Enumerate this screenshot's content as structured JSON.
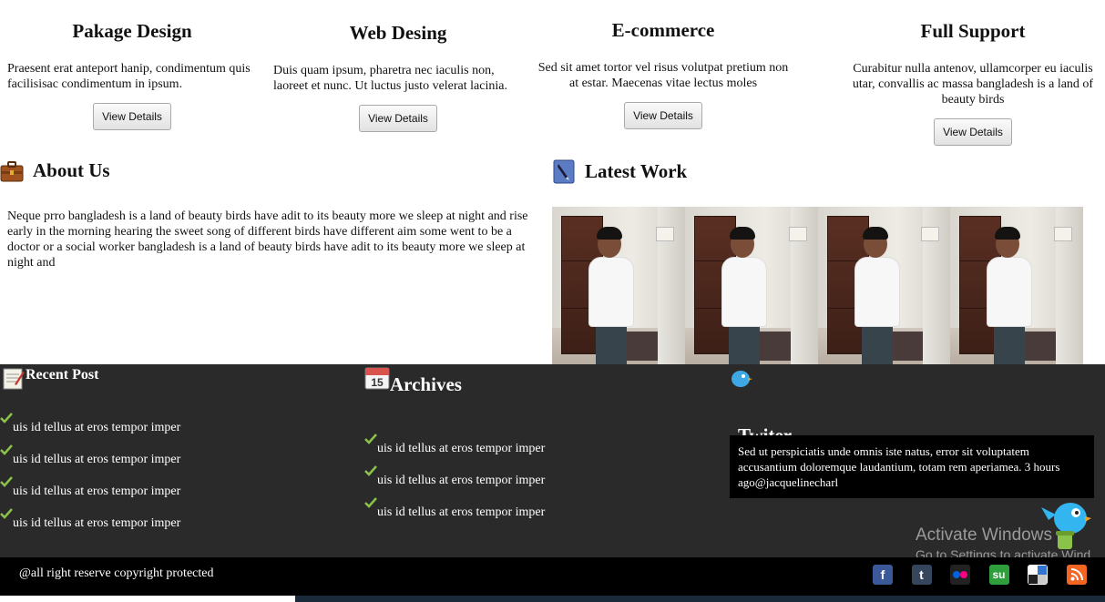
{
  "features": [
    {
      "title": "Pakage Design",
      "text": "Praesent erat anteport hanip, condimentum quis facilisisac condimentum in ipsum.",
      "button": "View Details"
    },
    {
      "title": "Web Desing",
      "text": "Duis quam ipsum, pharetra nec iaculis non, laoreet et nunc. Ut luctus justo velerat lacinia.",
      "button": "View Details"
    },
    {
      "title": "E-commerce",
      "text": "Sed sit amet tortor vel risus volutpat pretium non at estar. Maecenas vitae lectus moles",
      "button": "View Details"
    },
    {
      "title": "Full Support",
      "text": "Curabitur nulla antenov, ullamcorper eu iaculis utar, convallis ac massa bangladesh is a land of beauty birds",
      "button": "View Details"
    }
  ],
  "about": {
    "title": "About Us",
    "icon": "briefcase-icon",
    "text": "Neque prro bangladesh is a land of beauty birds have adit to its beauty more we sleep at night and rise early in the morning hearing the sweet song of different birds have different aim some went to be a doctor or a social worker bangladesh is a land of beauty birds have adit to its beauty more we sleep at night and"
  },
  "latest_work": {
    "title": "Latest Work",
    "icon": "pen-icon"
  },
  "footer": {
    "recent_post": {
      "title": "Recent Post",
      "icon": "notepad-icon",
      "items": [
        "uis id tellus at eros tempor imper",
        "uis id tellus at eros tempor imper",
        "uis id tellus at eros tempor imper",
        "uis id tellus at eros tempor imper"
      ]
    },
    "archives": {
      "title": "Archives",
      "icon": "calendar-icon",
      "icon_text": "15",
      "items": [
        "uis id tellus at eros tempor imper",
        "uis id tellus at eros tempor imper",
        "uis id tellus at eros tempor imper"
      ]
    },
    "twitter": {
      "title": "Twiter",
      "icon": "bird-icon",
      "tweet": "Sed ut perspiciatis unde omnis iste natus, error sit voluptatem accusantium doloremque laudantium, totam rem aperiamea. 3 hours ago@jacquelinecharl"
    },
    "watermark": {
      "line1": "Activate Windows",
      "line2": "Go to Settings to activate Wind"
    }
  },
  "bottom": {
    "copyright": "@all right reserve copyright protected",
    "socials": [
      {
        "name": "facebook-icon",
        "glyph": "f",
        "color": "#3b5998"
      },
      {
        "name": "tumblr-icon",
        "glyph": "t",
        "color": "#35465c"
      },
      {
        "name": "flickr-icon",
        "glyph": "••",
        "color": "#222222"
      },
      {
        "name": "stumbleupon-icon",
        "glyph": "su",
        "color": "#2f9e3c"
      },
      {
        "name": "delicious-icon",
        "glyph": "",
        "color": "#ffffff"
      },
      {
        "name": "rss-icon",
        "glyph": "◉",
        "color": "#f26522"
      }
    ]
  },
  "colors": {
    "footer_bg": "#2b2a2a",
    "bottom_bar_bg": "#000000",
    "check_green": "#8bc34a"
  }
}
